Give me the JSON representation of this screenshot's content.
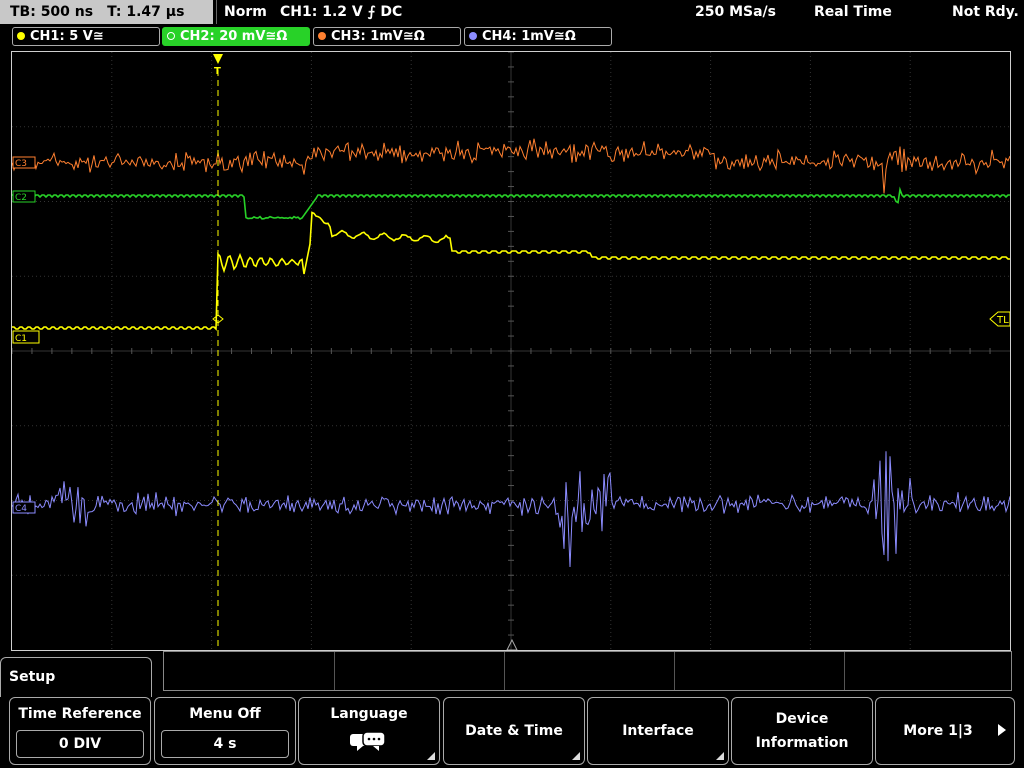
{
  "status_bar": {
    "timebase": "TB: 500 ns",
    "trigger_time": "T: 1.47 µs",
    "trigger_mode": "Norm",
    "trigger_source": "CH1: 1.2 V ⨍ DC",
    "sample_rate": "250 MSa/s",
    "acq_mode": "Real Time",
    "status": "Not Rdy."
  },
  "channels": [
    {
      "label": "CH1: 5 V≅",
      "color": "#ffff00",
      "active": false
    },
    {
      "label": "CH2: 20 mV≅Ω",
      "color": "#28d228",
      "active": true
    },
    {
      "label": "CH3: 1mV≅Ω",
      "color": "#ff8030",
      "active": false
    },
    {
      "label": "CH4: 1mV≅Ω",
      "color": "#8c8cff",
      "active": false
    }
  ],
  "markers": {
    "ch1": "C1",
    "ch2": "C2",
    "ch3": "C3",
    "ch4": "C4",
    "trigger_level": "TL",
    "trigger_position": "T"
  },
  "menu": {
    "title": "Setup",
    "softkeys": [
      {
        "label": "Time Reference",
        "value": "0 DIV"
      },
      {
        "label": "Menu Off",
        "value": "4 s"
      },
      {
        "label": "Language",
        "icon": "speech-bubble-icon"
      },
      {
        "label": "Date & Time"
      },
      {
        "label": "Interface"
      },
      {
        "label": "Device Information"
      },
      {
        "label": "More 1|3"
      }
    ]
  },
  "colors": {
    "ch1": "#ffff00",
    "ch2": "#28d228",
    "ch3": "#ff8030",
    "ch4": "#8c8cff",
    "grid": "#3c3c3c"
  }
}
